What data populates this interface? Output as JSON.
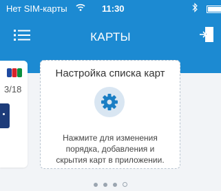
{
  "status_bar": {
    "carrier": "Нет SIM-карты",
    "time": "11:30"
  },
  "nav": {
    "title": "КАРТЫ",
    "menu_icon": "hamburger-menu-icon",
    "exit_icon": "exit-door-icon"
  },
  "left_card": {
    "expiry": "3/18",
    "logo_icon": "jcb-logo-icon"
  },
  "setup_card": {
    "title": "Настройка списка карт",
    "icon": "gear-icon",
    "description_line1": "Нажмите для изменения",
    "description_line2": "порядка, добавления и",
    "description_line3": "скрытия карт в приложении."
  },
  "pager": {
    "pages": 4,
    "active_index": 0
  },
  "colors": {
    "header": "#1c8ad2",
    "background": "#f2f4f7",
    "gear": "#1a7ec4"
  }
}
